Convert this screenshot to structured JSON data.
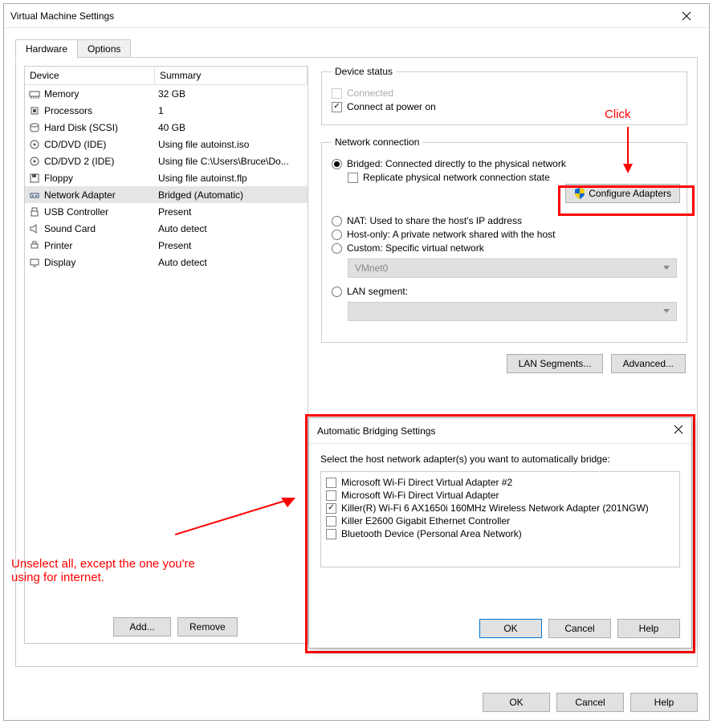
{
  "window": {
    "title": "Virtual Machine Settings"
  },
  "tabs": {
    "hardware": "Hardware",
    "options": "Options"
  },
  "table": {
    "head_device": "Device",
    "head_summary": "Summary",
    "rows": [
      {
        "name": "Memory",
        "summary": "32 GB",
        "icon": "memory"
      },
      {
        "name": "Processors",
        "summary": "1",
        "icon": "cpu"
      },
      {
        "name": "Hard Disk (SCSI)",
        "summary": "40 GB",
        "icon": "disk"
      },
      {
        "name": "CD/DVD (IDE)",
        "summary": "Using file autoinst.iso",
        "icon": "cd"
      },
      {
        "name": "CD/DVD 2 (IDE)",
        "summary": "Using file C:\\Users\\Bruce\\Do...",
        "icon": "cd"
      },
      {
        "name": "Floppy",
        "summary": "Using file autoinst.flp",
        "icon": "floppy"
      },
      {
        "name": "Network Adapter",
        "summary": "Bridged (Automatic)",
        "icon": "net",
        "selected": true
      },
      {
        "name": "USB Controller",
        "summary": "Present",
        "icon": "usb"
      },
      {
        "name": "Sound Card",
        "summary": "Auto detect",
        "icon": "sound"
      },
      {
        "name": "Printer",
        "summary": "Present",
        "icon": "printer"
      },
      {
        "name": "Display",
        "summary": "Auto detect",
        "icon": "display"
      }
    ]
  },
  "device_status": {
    "legend": "Device status",
    "connected": "Connected",
    "connect_power": "Connect at power on"
  },
  "netconn": {
    "legend": "Network connection",
    "bridged": "Bridged: Connected directly to the physical network",
    "replicate": "Replicate physical network connection state",
    "configure": "Configure Adapters",
    "nat": "NAT: Used to share the host's IP address",
    "hostonly": "Host-only: A private network shared with the host",
    "custom": "Custom: Specific virtual network",
    "vmnet": "VMnet0",
    "lanseg": "LAN segment:",
    "lan_btn": "LAN Segments...",
    "adv_btn": "Advanced..."
  },
  "left_buttons": {
    "add": "Add...",
    "remove": "Remove"
  },
  "footer": {
    "ok": "OK",
    "cancel": "Cancel",
    "help": "Help"
  },
  "annotations": {
    "click": "Click",
    "unselect": "Unselect all, except the one you're using for internet."
  },
  "bridge_dialog": {
    "title": "Automatic Bridging Settings",
    "instruction": "Select the host network adapter(s) you want to automatically bridge:",
    "adapters": [
      {
        "label": "Microsoft Wi-Fi Direct Virtual Adapter #2",
        "checked": false
      },
      {
        "label": "Microsoft Wi-Fi Direct Virtual Adapter",
        "checked": false
      },
      {
        "label": "Killer(R) Wi-Fi 6 AX1650i 160MHz Wireless Network Adapter (201NGW)",
        "checked": true
      },
      {
        "label": "Killer E2600 Gigabit Ethernet Controller",
        "checked": false
      },
      {
        "label": "Bluetooth Device (Personal Area Network)",
        "checked": false
      }
    ],
    "ok": "OK",
    "cancel": "Cancel",
    "help": "Help"
  }
}
